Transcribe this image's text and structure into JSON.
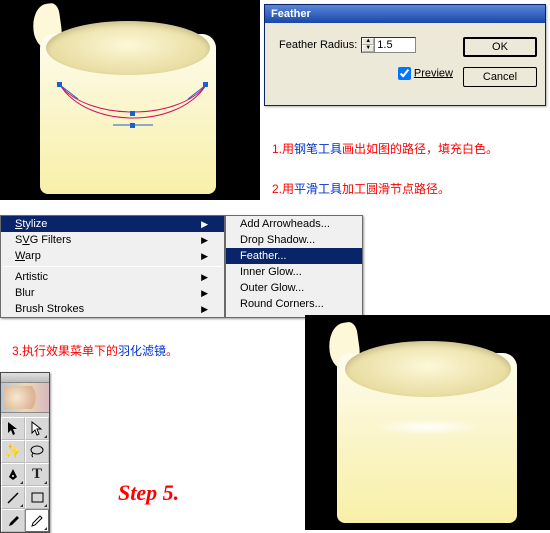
{
  "dialog": {
    "title": "Feather",
    "radius_label": "Feather Radius:",
    "radius_value": "1.5",
    "preview_label": "Preview",
    "preview_checked": true,
    "ok": "OK",
    "cancel": "Cancel"
  },
  "instructions": {
    "i1_pre": "1.用",
    "i1_blue": "钢笔工具",
    "i1_post": "画出如图的路径，填充白色。",
    "i2_pre": "2.用",
    "i2_blue": "平滑工具",
    "i2_post": "加工圆滑节点路径。",
    "i3_pre": "3.执行效果菜单下的",
    "i3_blue": "羽化滤镜",
    "i3_post": "。"
  },
  "step_label": "Step 5.",
  "menu": {
    "left": {
      "stylize": "Stylize",
      "svg_filters": "SVG Filters",
      "warp": "Warp",
      "artistic": "Artistic",
      "blur": "Blur",
      "brush_strokes": "Brush Strokes"
    },
    "right": {
      "add_arrowheads": "Add Arrowheads...",
      "drop_shadow": "Drop Shadow...",
      "feather": "Feather...",
      "inner_glow": "Inner Glow...",
      "outer_glow": "Outer Glow...",
      "round_corners": "Round Corners..."
    }
  },
  "tools": {
    "selection": "selection-tool",
    "direct_select": "direct-selection-tool",
    "magic_wand": "magic-wand-tool",
    "lasso": "lasso-tool",
    "pen": "pen-tool",
    "type": "type-tool",
    "line": "line-tool",
    "rectangle": "rectangle-tool",
    "paintbrush": "paintbrush-tool",
    "pencil": "pencil-tool"
  }
}
